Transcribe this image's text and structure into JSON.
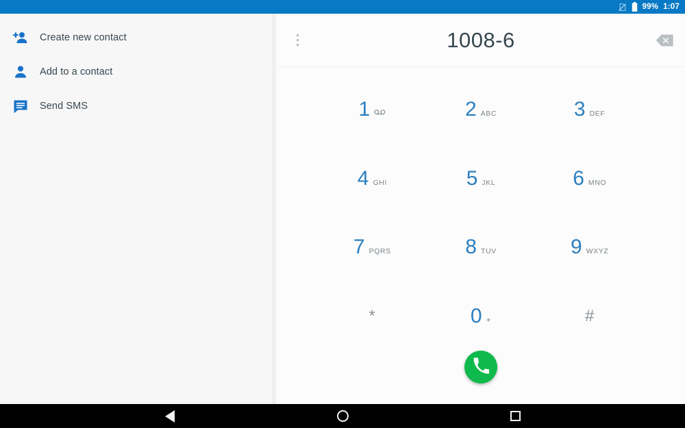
{
  "status_bar": {
    "background_color": "#0879c4",
    "sim_icon": "sim-disabled-icon",
    "battery_icon": "battery-full-icon",
    "battery_percent": "99%",
    "time": "1:07"
  },
  "sidebar": {
    "background_color": "#f7f7f7",
    "icon_color": "#1a73c8",
    "items": [
      {
        "label": "Create new contact",
        "icon": "person-add-icon"
      },
      {
        "label": "Add to a contact",
        "icon": "person-icon"
      },
      {
        "label": "Send SMS",
        "icon": "message-icon"
      }
    ]
  },
  "dialer": {
    "overflow_menu": "more-options-icon",
    "number": "1008-6",
    "backspace_icon": "backspace-icon",
    "digit_color": "#2a7fc0",
    "keys": [
      [
        {
          "digit": "1",
          "sub": "",
          "icon": "voicemail-icon",
          "gray": false
        },
        {
          "digit": "2",
          "sub": "ABC",
          "icon": "",
          "gray": false
        },
        {
          "digit": "3",
          "sub": "DEF",
          "icon": "",
          "gray": false
        }
      ],
      [
        {
          "digit": "4",
          "sub": "GHI",
          "icon": "",
          "gray": false
        },
        {
          "digit": "5",
          "sub": "JKL",
          "icon": "",
          "gray": false
        },
        {
          "digit": "6",
          "sub": "MNO",
          "icon": "",
          "gray": false
        }
      ],
      [
        {
          "digit": "7",
          "sub": "PQRS",
          "icon": "",
          "gray": false
        },
        {
          "digit": "8",
          "sub": "TUV",
          "icon": "",
          "gray": false
        },
        {
          "digit": "9",
          "sub": "WXYZ",
          "icon": "",
          "gray": false
        }
      ],
      [
        {
          "digit": "*",
          "sub": "",
          "icon": "",
          "gray": true
        },
        {
          "digit": "0",
          "sub": "+",
          "icon": "",
          "gray": false
        },
        {
          "digit": "#",
          "sub": "",
          "icon": "",
          "gray": true
        }
      ]
    ],
    "call_button": {
      "icon": "phone-call-icon",
      "color": "#0fb94b"
    }
  },
  "navigation_bar": {
    "background_color": "#000000",
    "buttons": [
      {
        "name": "back-button",
        "icon": "triangle-back-icon"
      },
      {
        "name": "home-button",
        "icon": "circle-home-icon"
      },
      {
        "name": "recents-button",
        "icon": "square-recents-icon"
      }
    ]
  }
}
